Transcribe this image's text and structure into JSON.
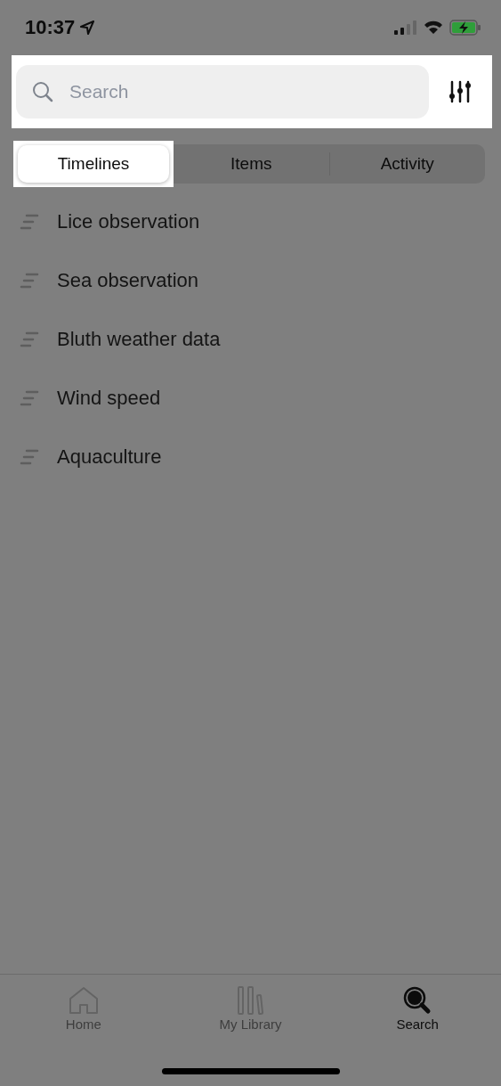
{
  "status_bar": {
    "time": "10:37"
  },
  "search": {
    "placeholder": "Search"
  },
  "tabs": [
    {
      "label": "Timelines",
      "selected": true
    },
    {
      "label": "Items",
      "selected": false
    },
    {
      "label": "Activity",
      "selected": false
    }
  ],
  "timelines": [
    {
      "name": "Lice observation"
    },
    {
      "name": "Sea observation"
    },
    {
      "name": "Bluth weather data"
    },
    {
      "name": "Wind speed"
    },
    {
      "name": "Aquaculture"
    }
  ],
  "tab_bar": [
    {
      "label": "Home",
      "kind": "home",
      "selected": false
    },
    {
      "label": "My Library",
      "kind": "library",
      "selected": false
    },
    {
      "label": "Search",
      "kind": "search",
      "selected": true
    }
  ]
}
